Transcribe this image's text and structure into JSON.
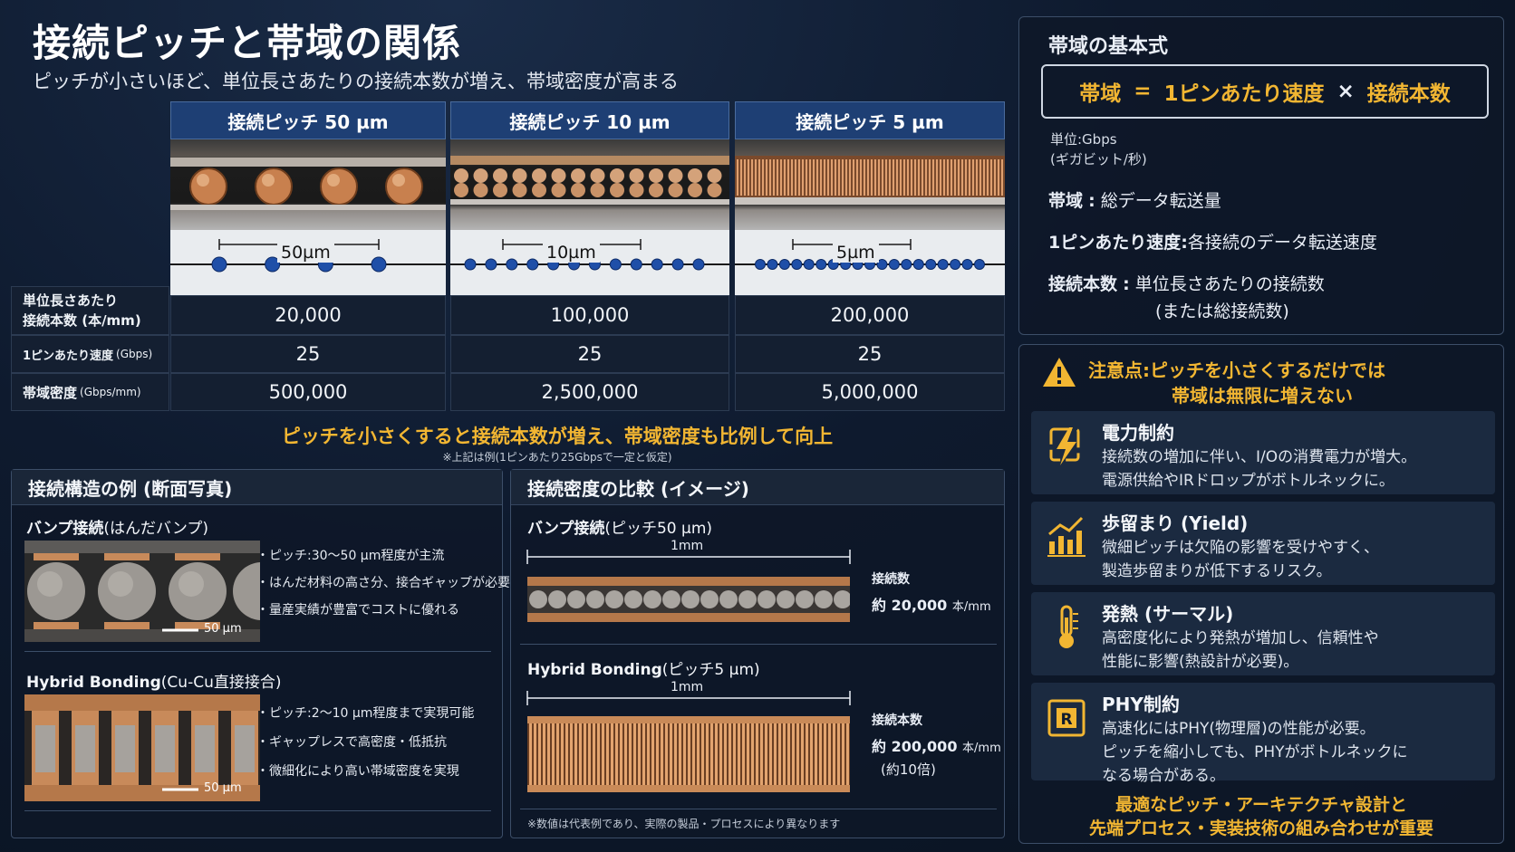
{
  "header": {
    "title": "接続ピッチと帯域の関係",
    "subtitle": "ピッチが小さいほど、単位長さあたりの接続本数が増え、帯域密度が高まる"
  },
  "pitch_table": {
    "columns": [
      {
        "label": "接続ピッチ 50 µm",
        "dim": "50µm",
        "density": "20,000",
        "speed": "25",
        "bandwidth": "500,000"
      },
      {
        "label": "接続ピッチ 10 µm",
        "dim": "10µm",
        "density": "100,000",
        "speed": "25",
        "bandwidth": "2,500,000"
      },
      {
        "label": "接続ピッチ 5 µm",
        "dim": "5µm",
        "density": "200,000",
        "speed": "25",
        "bandwidth": "5,000,000"
      }
    ],
    "row_labels": {
      "density_line1": "単位長さあたり",
      "density_line2": "接続本数 (本/mm)",
      "speed_main": "1ピンあたり速度",
      "speed_unit": "(Gbps)",
      "bandwidth_main": "帯域密度",
      "bandwidth_unit": "(Gbps/mm)"
    },
    "conclusion": "ピッチを小さくすると接続本数が増え、帯域密度も比例して向上",
    "footnote": "※上記は例(1ピンあたり25Gbpsで一定と仮定)"
  },
  "structure_panel": {
    "title": "接続構造の例 (断面写真)",
    "bump": {
      "heading": "バンプ接続",
      "heading_sub": "(はんだバンプ)",
      "scale": "50 µm",
      "bullets": [
        "・ピッチ:30〜50 µm程度が主流",
        "・はんだ材料の高さ分、接合ギャップが必要",
        "・量産実績が豊富でコストに優れる"
      ]
    },
    "hybrid": {
      "heading": "Hybrid Bonding",
      "heading_sub": "(Cu-Cu直接接合)",
      "scale": "50 µm",
      "bullets": [
        "・ピッチ:2〜10 µm程度まで実現可能",
        "・ギャップレスで高密度・低抵抗",
        "・微細化により高い帯域密度を実現"
      ]
    }
  },
  "density_panel": {
    "title": "接続密度の比較 (イメージ)",
    "bump": {
      "heading": "バンプ接続",
      "heading_sub": "(ピッチ50 µm)",
      "span": "1mm",
      "count_label": "接続数",
      "count_value": "約 20,000",
      "count_unit": "本/mm"
    },
    "hybrid": {
      "heading": "Hybrid Bonding",
      "heading_sub": "(ピッチ5 µm)",
      "span": "1mm",
      "count_label": "接続本数",
      "count_value": "約 200,000",
      "count_unit": "本/mm",
      "ratio": "(約10倍)"
    },
    "footnote": "※数値は代表例であり、実際の製品・プロセスにより異なります"
  },
  "formula_panel": {
    "title": "帯域の基本式",
    "formula": {
      "lhs": "帯域",
      "eq": "=",
      "term1": "1ピンあたり速度",
      "times": "×",
      "term2": "接続本数"
    },
    "unit_line1": "単位:Gbps",
    "unit_line2": "(ギガビット/秒)",
    "defs": [
      {
        "term": "帯域",
        "sep": ":",
        "desc": "総データ転送量"
      },
      {
        "term": "1ピンあたり速度",
        "sep": ":",
        "desc": "各接続のデータ転送速度"
      },
      {
        "term": "接続本数",
        "sep": ":",
        "desc": "単位長さあたりの接続数",
        "desc2": "(または総接続数)"
      }
    ]
  },
  "caution_panel": {
    "title_line1": "注意点:ピッチを小さくするだけでは",
    "title_line2": "帯域は無限に増えない",
    "items": [
      {
        "icon": "power-icon",
        "title": "電力制約",
        "line1": "接続数の増加に伴い、I/Oの消費電力が増大。",
        "line2": "電源供給やIRドロップがボトルネックに。"
      },
      {
        "icon": "yield-chart-icon",
        "title": "歩留まり (Yield)",
        "line1": "微細ピッチは欠陥の影響を受けやすく、",
        "line2": "製造歩留まりが低下するリスク。"
      },
      {
        "icon": "thermometer-icon",
        "title": "発熱 (サーマル)",
        "line1": "高密度化により発熱が増加し、信頼性や",
        "line2": "性能に影響(熱設計が必要)。"
      },
      {
        "icon": "phy-chip-icon",
        "title": "PHY制約",
        "line1": "高速化にはPHY(物理層)の性能が必要。",
        "line2": "ピッチを縮小しても、PHYがボトルネックに",
        "line3": "なる場合がある。"
      }
    ],
    "conclusion_line1": "最適なピッチ・アーキテクチャ設計と",
    "conclusion_line2": "先端プロセス・実装技術の組み合わせが重要"
  },
  "colors": {
    "accent_gold": "#f2b632",
    "header_blue": "#1e3f74",
    "dot_blue": "#1f4fa8"
  }
}
